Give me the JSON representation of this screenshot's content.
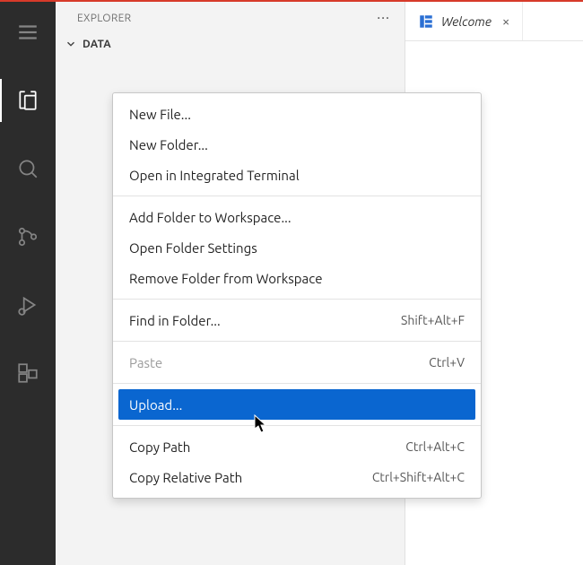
{
  "side": {
    "title": "EXPLORER",
    "more": "···",
    "root": "DATA"
  },
  "tab": {
    "label": "Welcome",
    "close": "×"
  },
  "ctx": {
    "group1": [
      {
        "label": "New File...",
        "shortcut": ""
      },
      {
        "label": "New Folder...",
        "shortcut": ""
      },
      {
        "label": "Open in Integrated Terminal",
        "shortcut": ""
      }
    ],
    "group2": [
      {
        "label": "Add Folder to Workspace...",
        "shortcut": ""
      },
      {
        "label": "Open Folder Settings",
        "shortcut": ""
      },
      {
        "label": "Remove Folder from Workspace",
        "shortcut": ""
      }
    ],
    "group3": [
      {
        "label": "Find in Folder...",
        "shortcut": "Shift+Alt+F"
      }
    ],
    "group4": [
      {
        "label": "Paste",
        "shortcut": "Ctrl+V",
        "disabled": true
      }
    ],
    "group5": [
      {
        "label": "Upload...",
        "shortcut": "",
        "highlight": true
      }
    ],
    "group6": [
      {
        "label": "Copy Path",
        "shortcut": "Ctrl+Alt+C"
      },
      {
        "label": "Copy Relative Path",
        "shortcut": "Ctrl+Shift+Alt+C"
      }
    ]
  }
}
